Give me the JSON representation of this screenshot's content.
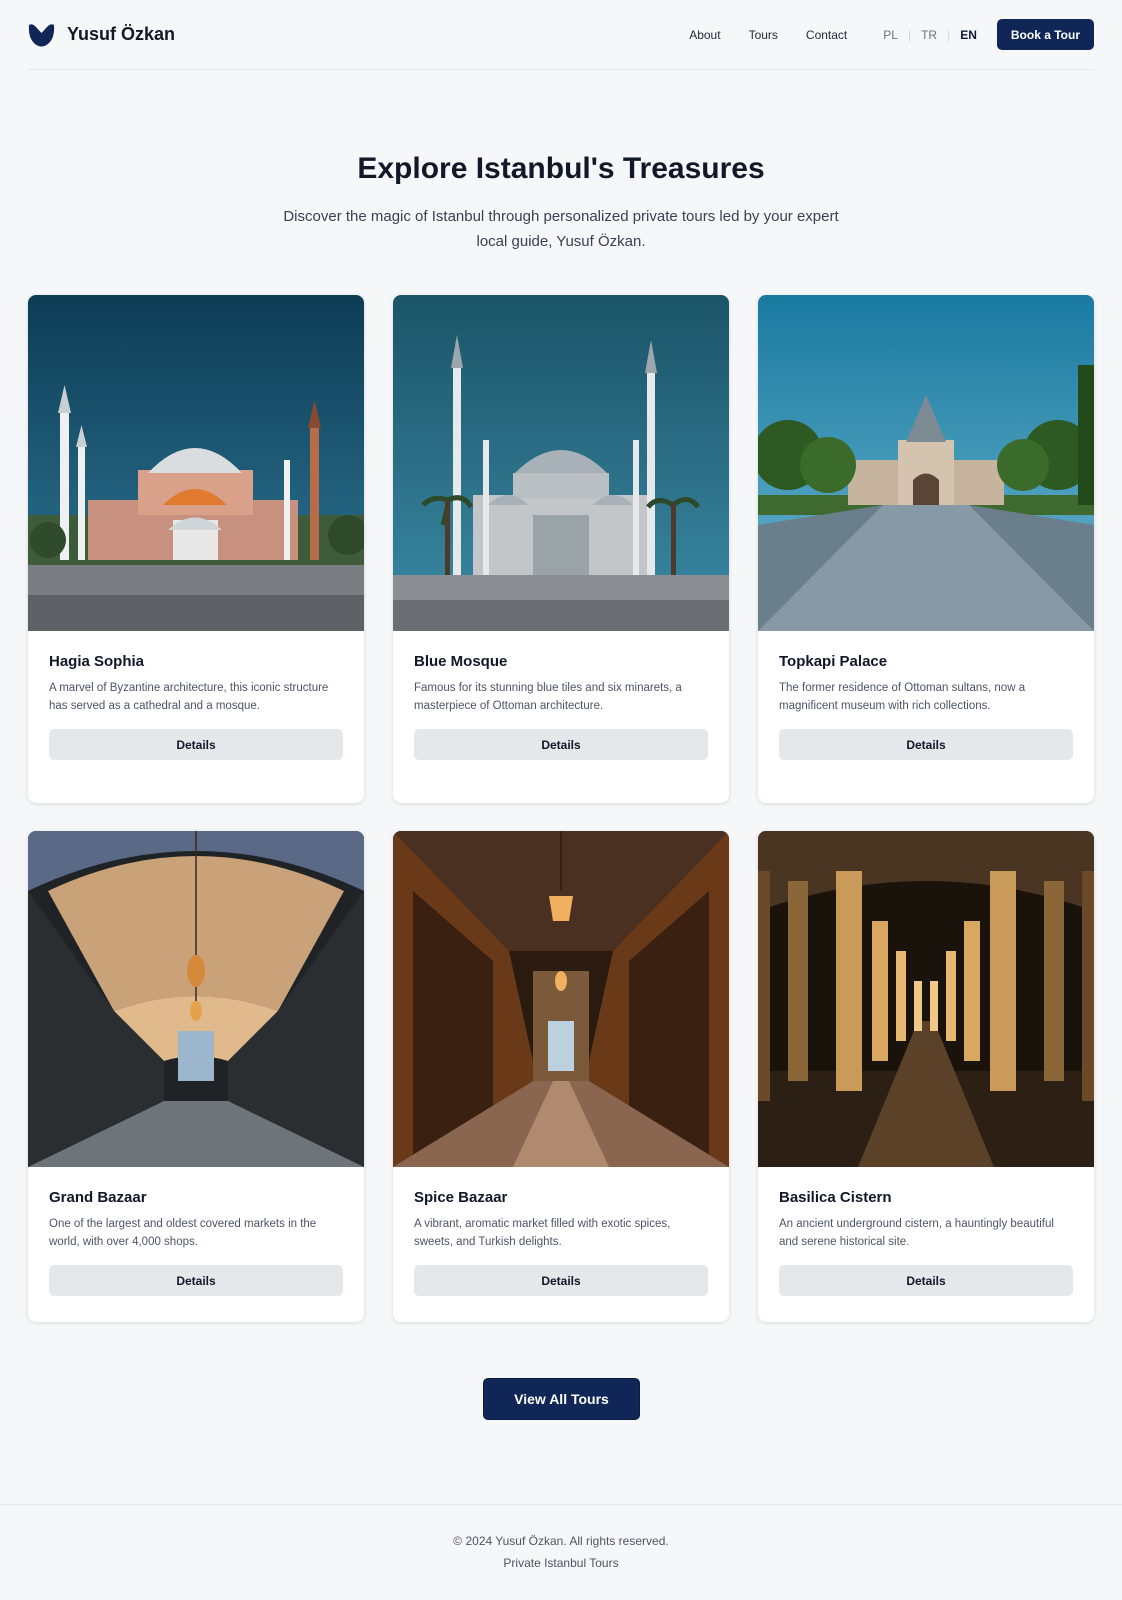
{
  "header": {
    "brand_name": "Yusuf Özkan",
    "nav": [
      {
        "label": "About"
      },
      {
        "label": "Tours"
      },
      {
        "label": "Contact"
      }
    ],
    "languages": [
      {
        "label": "PL",
        "active": false
      },
      {
        "label": "TR",
        "active": false
      },
      {
        "label": "EN",
        "active": true
      }
    ],
    "cta_label": "Book a Tour"
  },
  "hero": {
    "title": "Explore Istanbul's Treasures",
    "subtitle": "Discover the magic of Istanbul through personalized private tours led by your expert local guide, Yusuf Özkan."
  },
  "tours": [
    {
      "title": "Hagia Sophia",
      "description": "A marvel of Byzantine architecture, this iconic structure has served as a cathedral and a mosque.",
      "button": "Details",
      "image": "hagia-sophia-photo"
    },
    {
      "title": "Blue Mosque",
      "description": "Famous for its stunning blue tiles and six minarets, a masterpiece of Ottoman architecture.",
      "button": "Details",
      "image": "blue-mosque-photo"
    },
    {
      "title": "Topkapi Palace",
      "description": "The former residence of Ottoman sultans, now a magnificent museum with rich collections.",
      "button": "Details",
      "image": "topkapi-palace-photo"
    },
    {
      "title": "Grand Bazaar",
      "description": "One of the largest and oldest covered markets in the world, with over 4,000 shops.",
      "button": "Details",
      "image": "grand-bazaar-photo"
    },
    {
      "title": "Spice Bazaar",
      "description": "A vibrant, aromatic market filled with exotic spices, sweets, and Turkish delights.",
      "button": "Details",
      "image": "spice-bazaar-photo"
    },
    {
      "title": "Basilica Cistern",
      "description": "An ancient underground cistern, a hauntingly beautiful and serene historical site.",
      "button": "Details",
      "image": "basilica-cistern-photo"
    }
  ],
  "view_all_label": "View All Tours",
  "footer": {
    "copyright": "© 2024 Yusuf Özkan. All rights reserved.",
    "tagline": "Private Istanbul Tours"
  },
  "colors": {
    "primary": "#0f2656",
    "background": "#f6f7f9",
    "secondary_button": "#e5e7eb"
  }
}
